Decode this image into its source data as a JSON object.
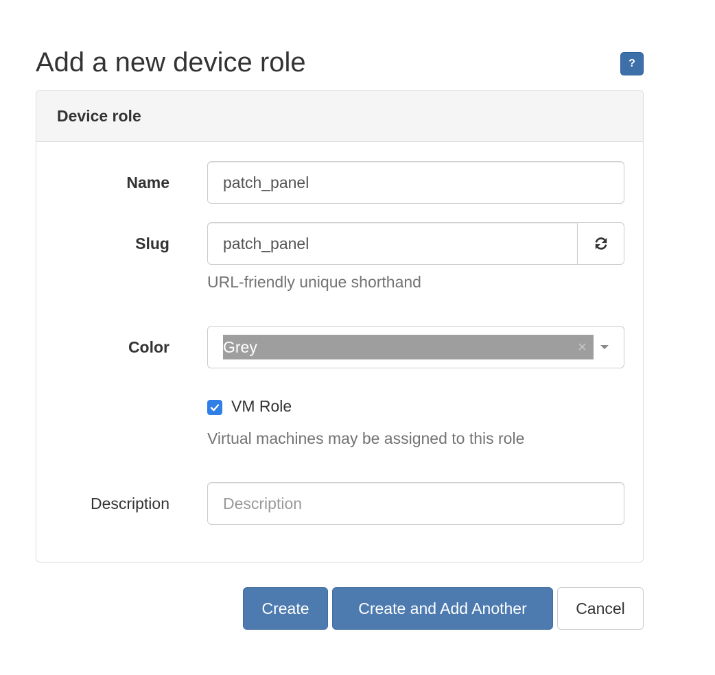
{
  "page": {
    "title": "Add a new device role",
    "help_label": "?"
  },
  "panel": {
    "heading": "Device role"
  },
  "form": {
    "name": {
      "label": "Name",
      "value": "patch_panel"
    },
    "slug": {
      "label": "Slug",
      "value": "patch_panel",
      "help": "URL-friendly unique shorthand",
      "regen_icon": "refresh-icon"
    },
    "color": {
      "label": "Color",
      "selected": "Grey",
      "selected_color": "#9e9e9e",
      "clear_glyph": "×"
    },
    "vm_role": {
      "label": "VM Role",
      "checked": true,
      "help": "Virtual machines may be assigned to this role"
    },
    "description": {
      "label": "Description",
      "value": "",
      "placeholder": "Description"
    }
  },
  "actions": {
    "create": "Create",
    "create_another": "Create and Add Another",
    "cancel": "Cancel"
  },
  "colors": {
    "primary": "#4d7bb0",
    "help_button": "#3d6fa8",
    "checkbox": "#2f7fe6"
  }
}
